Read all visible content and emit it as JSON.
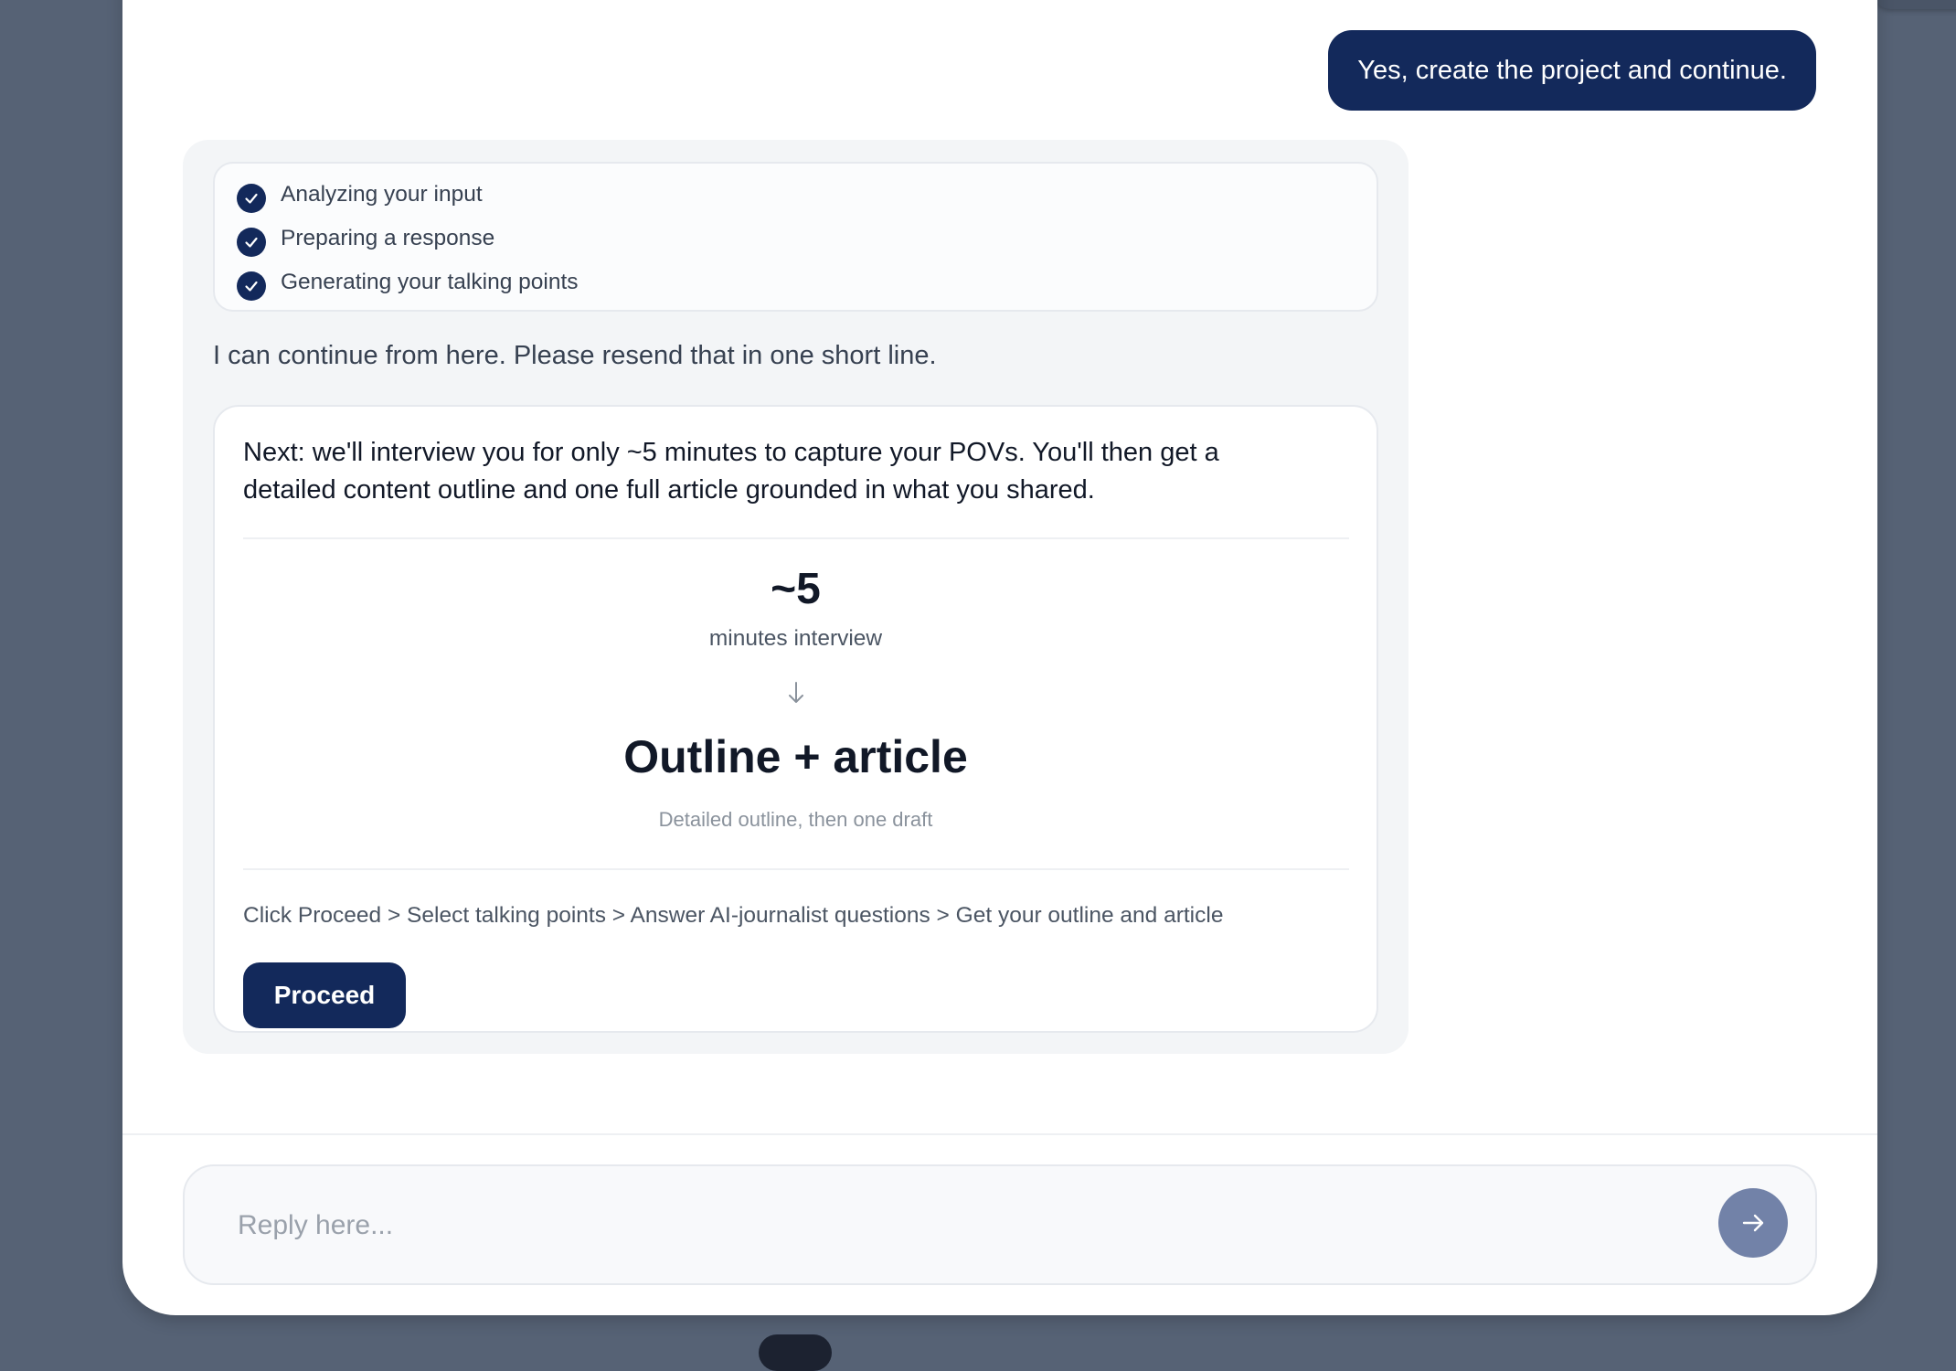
{
  "user_message": "Yes, create the project and continue.",
  "progress_steps": [
    {
      "label": "Analyzing your input",
      "status": "done"
    },
    {
      "label": "Preparing a response",
      "status": "done"
    },
    {
      "label": "Generating your talking points",
      "status": "done"
    }
  ],
  "assistant_message": "I can continue from here. Please resend that in one short line.",
  "card": {
    "intro": "Next: we'll interview you for only ~5 minutes to capture your POVs. You'll then get a detailed content outline and one full article grounded in what you shared.",
    "metric_value": "~5",
    "metric_caption": "minutes interview",
    "result_title": "Outline + article",
    "result_caption": "Detailed outline, then one draft",
    "flow_text": "Click Proceed > Select talking points > Answer AI-journalist questions > Get your outline and article",
    "proceed_label": "Proceed"
  },
  "composer": {
    "placeholder": "Reply here..."
  },
  "icons": {
    "step_status": "check-circle-icon",
    "flow": "arrow-down-icon",
    "send": "arrow-right-icon"
  },
  "colors": {
    "accent": "#13295b",
    "send_button": "#7282a8",
    "backdrop": "#566275"
  }
}
